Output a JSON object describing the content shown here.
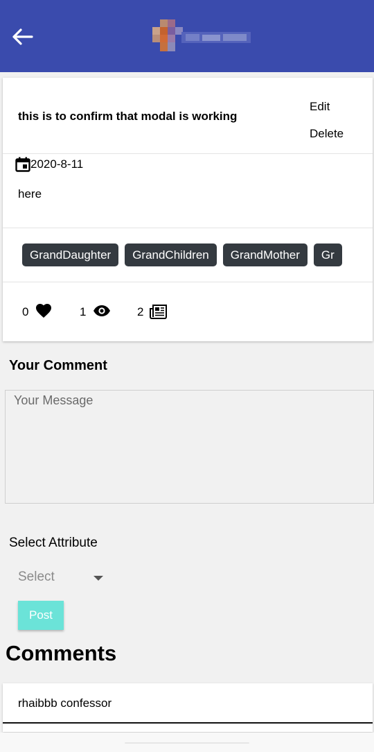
{
  "post": {
    "title": "this is to confirm that modal is working",
    "menu": {
      "edit": "Edit",
      "delete": "Delete"
    },
    "date": "2020-8-11",
    "body": "here",
    "tags": [
      "GrandDaughter",
      "GrandChildren",
      "GrandMother",
      "Gr"
    ],
    "stats": {
      "likes": "0",
      "views": "1",
      "comments": "2"
    }
  },
  "comment_form": {
    "heading": "Your Comment",
    "message_placeholder": "Your Message",
    "attribute_label": "Select Attribute",
    "select_value": "Select",
    "post_label": "Post"
  },
  "comments": {
    "heading": "Comments",
    "items": [
      {
        "author": "rhaibbb confessor"
      }
    ]
  },
  "colors": {
    "appbar": "#3a4bad",
    "chip": "#343a40",
    "post_button": "#6be3d8"
  },
  "icons": [
    "back-arrow-icon",
    "calendar-icon",
    "heart-icon",
    "eye-icon",
    "newspaper-icon",
    "chevron-down-icon"
  ]
}
